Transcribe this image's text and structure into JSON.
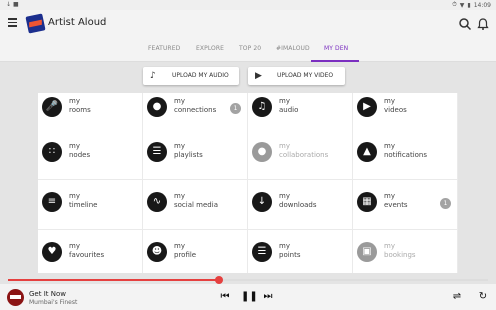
{
  "status_bar": {
    "time": "14:09"
  },
  "app": {
    "title": "Artist Aloud"
  },
  "tabs": [
    {
      "label": "FEATURED"
    },
    {
      "label": "EXPLORE"
    },
    {
      "label": "TOP 20"
    },
    {
      "label": "#IMALOUD"
    },
    {
      "label": "MY DEN",
      "active": true
    }
  ],
  "uploads": {
    "audio": "UPLOAD MY AUDIO",
    "video": "UPLOAD MY VIDEO"
  },
  "grid": [
    {
      "line1": "my",
      "line2": "rooms",
      "icon": "microphone-icon"
    },
    {
      "line1": "my",
      "line2": "connections",
      "icon": "connections-icon",
      "badge": "1"
    },
    {
      "line1": "my",
      "line2": "audio",
      "icon": "music-note-icon"
    },
    {
      "line1": "my",
      "line2": "videos",
      "icon": "video-icon"
    },
    {
      "line1": "my",
      "line2": "nodes",
      "icon": "nodes-icon"
    },
    {
      "line1": "my",
      "line2": "playlists",
      "icon": "playlist-icon"
    },
    {
      "line1": "my",
      "line2": "collaborations",
      "icon": "collaboration-icon",
      "disabled": true
    },
    {
      "line1": "my",
      "line2": "notifications",
      "icon": "bell-icon"
    },
    {
      "line1": "my",
      "line2": "timeline",
      "icon": "timeline-icon"
    },
    {
      "line1": "my",
      "line2": "social media",
      "icon": "rss-icon"
    },
    {
      "line1": "my",
      "line2": "downloads",
      "icon": "download-icon"
    },
    {
      "line1": "my",
      "line2": "events",
      "icon": "calendar-icon",
      "badge": "1"
    },
    {
      "line1": "my",
      "line2": "favourites",
      "icon": "heart-icon"
    },
    {
      "line1": "my",
      "line2": "profile",
      "icon": "profile-icon"
    },
    {
      "line1": "my",
      "line2": "points",
      "icon": "points-icon"
    },
    {
      "line1": "my",
      "line2": "bookings",
      "icon": "bookings-icon",
      "disabled": true
    }
  ],
  "player": {
    "song": "Get It Now",
    "artist": "Mumbai's Finest",
    "progress": 0.44
  },
  "colors": {
    "accent": "#7b2fc0",
    "progress": "#e5403f",
    "icon_dark": "#181818",
    "icon_disabled": "#9a9a9a"
  }
}
